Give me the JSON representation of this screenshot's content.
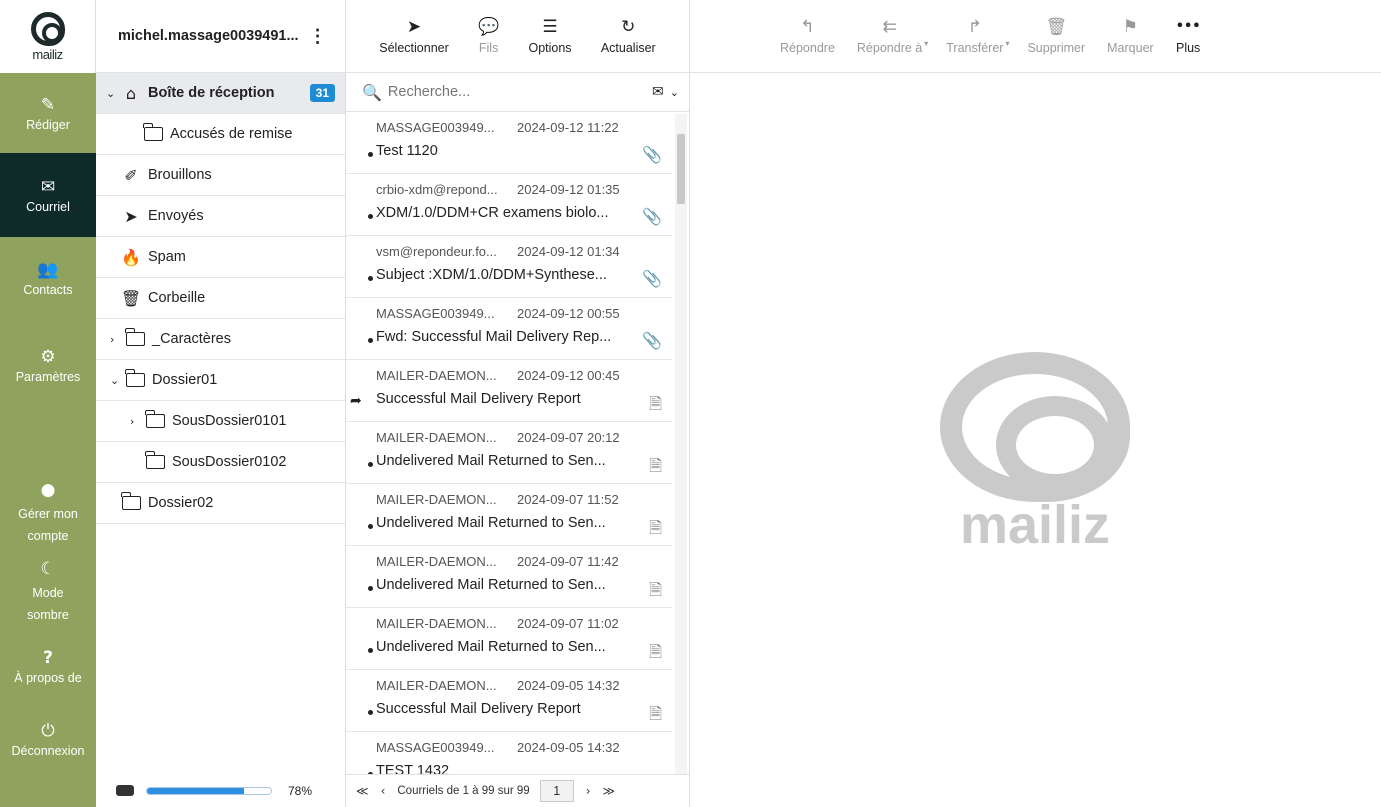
{
  "rail": {
    "brand": "mailiz",
    "items": [
      {
        "label": "Rédiger",
        "icon": "✎"
      },
      {
        "label": "Courriel",
        "icon": "✉"
      },
      {
        "label": "Contacts",
        "icon": "👥"
      },
      {
        "label": "Paramètres",
        "icon": "⚙"
      },
      {
        "label": "Gérer mon compte",
        "icon": "●"
      },
      {
        "label": "Mode sombre",
        "icon": "☾"
      },
      {
        "label": "À propos de",
        "icon": "?"
      },
      {
        "label": "Déconnexion",
        "icon": "⏻"
      }
    ]
  },
  "account": {
    "name": "michel.massage0039491...",
    "menu_icon": "⋮"
  },
  "folders": [
    {
      "name": "Boîte de réception",
      "chev": "⌄",
      "icon": "⌂",
      "badge": "31"
    },
    {
      "name": "Accusés de remise",
      "chev": "",
      "icon": "folder"
    },
    {
      "name": "Brouillons",
      "chev": "",
      "icon": "✐"
    },
    {
      "name": "Envoyés",
      "chev": "",
      "icon": "➤"
    },
    {
      "name": "Spam",
      "chev": "",
      "icon": "🔥"
    },
    {
      "name": "Corbeille",
      "chev": "",
      "icon": "🗑"
    },
    {
      "name": "_Caractères",
      "chev": "›",
      "icon": "folder"
    },
    {
      "name": "Dossier01",
      "chev": "⌄",
      "icon": "folder"
    },
    {
      "name": "SousDossier0101",
      "chev": "›",
      "icon": "folder"
    },
    {
      "name": "SousDossier0102",
      "chev": "",
      "icon": "folder"
    },
    {
      "name": "Dossier02",
      "chev": "",
      "icon": "folder"
    }
  ],
  "quota": {
    "percent": 78,
    "label": "78%"
  },
  "list_toolbar": [
    {
      "label": "Sélectionner",
      "icon": "➤"
    },
    {
      "label": "Fils",
      "icon": "💬"
    },
    {
      "label": "Options",
      "icon": "☰"
    },
    {
      "label": "Actualiser",
      "icon": "↻"
    }
  ],
  "search": {
    "placeholder": "Recherche...",
    "icon": "🔍",
    "envelope": "✉",
    "dropdown": "⌄"
  },
  "messages": [
    {
      "from": "MASSAGE003949...",
      "date": "2024-09-12 11:22",
      "subject": "Test 1120",
      "icon": "📎"
    },
    {
      "from": "crbio-xdm@repond...",
      "date": "2024-09-12 01:35",
      "subject": "XDM/1.0/DDM+CR examens biolo...",
      "icon": "📎"
    },
    {
      "from": "vsm@repondeur.fo...",
      "date": "2024-09-12 01:34",
      "subject": "Subject :XDM/1.0/DDM+Synthese...",
      "icon": "📎"
    },
    {
      "from": "MASSAGE003949...",
      "date": "2024-09-12 00:55",
      "subject": "Fwd: Successful Mail Delivery Rep...",
      "icon": "📎"
    },
    {
      "from": "MAILER-DAEMON...",
      "date": "2024-09-12 00:45",
      "subject": "Successful Mail Delivery Report",
      "icon": "🗎",
      "forwarded": true
    },
    {
      "from": "MAILER-DAEMON...",
      "date": "2024-09-07 20:12",
      "subject": "Undelivered Mail Returned to Sen...",
      "icon": "🗎"
    },
    {
      "from": "MAILER-DAEMON...",
      "date": "2024-09-07 11:52",
      "subject": "Undelivered Mail Returned to Sen...",
      "icon": "🗎"
    },
    {
      "from": "MAILER-DAEMON...",
      "date": "2024-09-07 11:42",
      "subject": "Undelivered Mail Returned to Sen...",
      "icon": "🗎"
    },
    {
      "from": "MAILER-DAEMON...",
      "date": "2024-09-07 11:02",
      "subject": "Undelivered Mail Returned to Sen...",
      "icon": "🗎"
    },
    {
      "from": "MAILER-DAEMON...",
      "date": "2024-09-05 14:32",
      "subject": "Successful Mail Delivery Report",
      "icon": "🗎"
    },
    {
      "from": "MASSAGE003949...",
      "date": "2024-09-05 14:32",
      "subject": "TEST 1432",
      "icon": ""
    }
  ],
  "pager": {
    "first": "≪",
    "prev": "‹",
    "info": "Courriels de 1 à 99 sur 99",
    "page": "1",
    "next": "›",
    "last": "≫"
  },
  "read_toolbar": [
    {
      "label": "Répondre",
      "icon": "↰",
      "caret": ""
    },
    {
      "label": "Répondre à",
      "icon": "⇇",
      "caret": "▾"
    },
    {
      "label": "Transférer",
      "icon": "↱",
      "caret": "▾"
    },
    {
      "label": "Supprimer",
      "icon": "🗑",
      "caret": ""
    },
    {
      "label": "Marquer",
      "icon": "⚑",
      "caret": ""
    },
    {
      "label": "Plus",
      "icon": "•••",
      "caret": ""
    }
  ],
  "watermark": {
    "text": "mailiz"
  }
}
